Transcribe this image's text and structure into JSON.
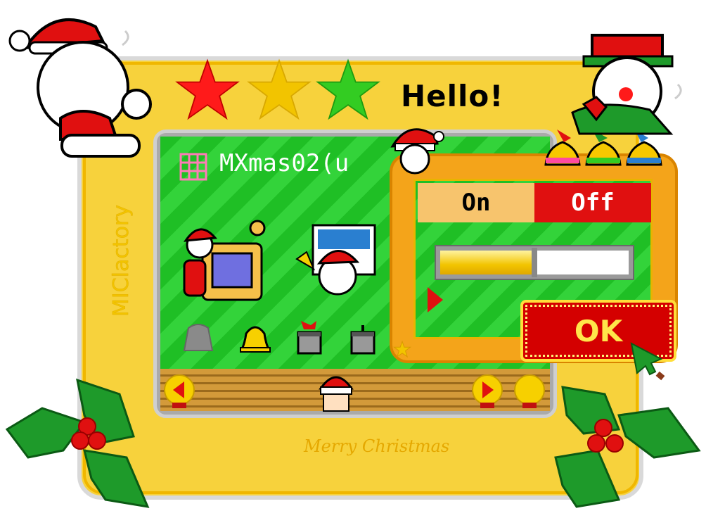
{
  "window": {
    "title": "Hello!",
    "side_label": "MIClactory",
    "bottom_signature": "Merry Christmas"
  },
  "screen": {
    "window_title": "MXmas02(u",
    "desktop_icons": [
      "santa-mac-icon",
      "santa-window-icon",
      "trash-icon",
      "bell-icon",
      "gift-box-icon",
      "trash-can-icon"
    ]
  },
  "dock": {
    "left_arrow": "◀",
    "right_arrow": "▶"
  },
  "popup": {
    "toggle": {
      "on_label": "On",
      "off_label": "Off",
      "selected": "Off"
    },
    "slider": {
      "value_fraction": 0.5
    },
    "ok_label": "OK"
  },
  "colors": {
    "frame": "#f7d23c",
    "desktop_green": "#1fbf25",
    "popup_orange": "#f4a41a",
    "off_red": "#e01010",
    "ok_red": "#d40000",
    "star_colors": [
      "#ff1a1a",
      "#f2c400",
      "#33cc22"
    ]
  }
}
